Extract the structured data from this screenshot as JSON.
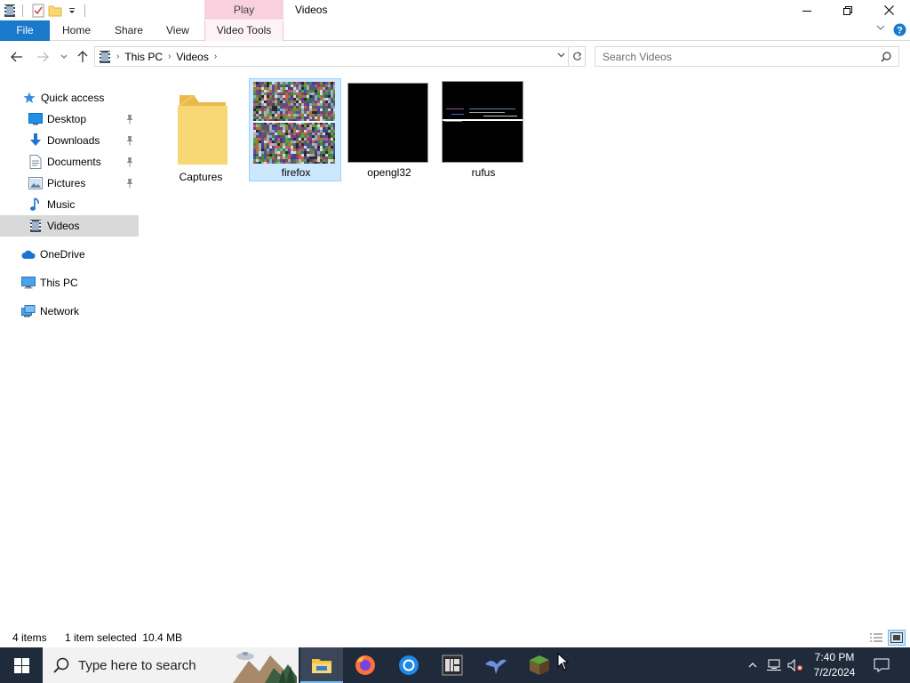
{
  "window": {
    "context_tab": "Play",
    "title": "Videos"
  },
  "ribbon": {
    "tabs": [
      "File",
      "Home",
      "Share",
      "View",
      "Video Tools"
    ]
  },
  "address": {
    "crumbs": [
      "This PC",
      "Videos"
    ]
  },
  "search": {
    "placeholder": "Search Videos"
  },
  "nav": {
    "quick_access": "Quick access",
    "items": [
      {
        "label": "Desktop",
        "icon": "desktop-icon",
        "pinned": true
      },
      {
        "label": "Downloads",
        "icon": "downloads-icon",
        "pinned": true
      },
      {
        "label": "Documents",
        "icon": "documents-icon",
        "pinned": true
      },
      {
        "label": "Pictures",
        "icon": "pictures-icon",
        "pinned": true
      },
      {
        "label": "Music",
        "icon": "music-icon",
        "pinned": false
      },
      {
        "label": "Videos",
        "icon": "videos-icon",
        "pinned": false
      }
    ],
    "onedrive": "OneDrive",
    "this_pc": "This PC",
    "network": "Network"
  },
  "files": [
    {
      "name": "Captures",
      "type": "folder",
      "selected": false
    },
    {
      "name": "firefox",
      "type": "video",
      "selected": true
    },
    {
      "name": "opengl32",
      "type": "video",
      "selected": false
    },
    {
      "name": "rufus",
      "type": "video",
      "selected": false
    }
  ],
  "status": {
    "count": "4 items",
    "selection": "1 item selected  10.4 MB"
  },
  "taskbar": {
    "search_text": "Type here to search",
    "apps": [
      "file-explorer-icon",
      "firefox-icon",
      "chrome-icon",
      "bw-app-icon",
      "bird-app-icon",
      "minecraft-icon"
    ],
    "time": "7:40 PM",
    "date": "7/2/2024"
  },
  "colors": {
    "accent": "#1979ca",
    "selection": "#cce8ff",
    "taskbar": "#1f2a3b",
    "play_tab": "#f9d0de"
  }
}
